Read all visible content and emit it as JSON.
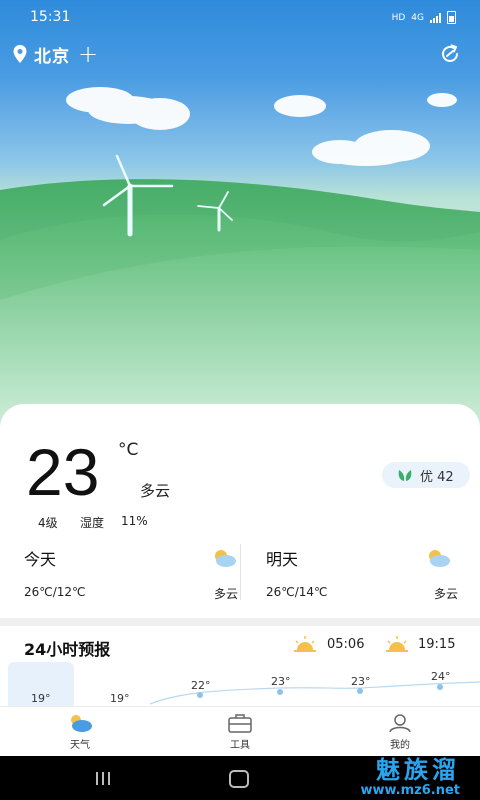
{
  "status_bar": {
    "time": "15:31",
    "network_badge": "HD",
    "network_type": "4G"
  },
  "location": {
    "city": "北京",
    "add_icon": "+"
  },
  "current": {
    "temperature": "23",
    "unit": "°C",
    "condition": "多云",
    "wind": "4级",
    "humidity_label": "湿度",
    "humidity": "11%",
    "aqi": "优 42"
  },
  "today": {
    "label": "今天",
    "range": "26℃/12℃",
    "condition": "多云"
  },
  "tomorrow": {
    "label": "明天",
    "range": "26℃/14℃",
    "condition": "多云"
  },
  "forecast": {
    "title": "24小时预报",
    "sunrise": "05:06",
    "sunset": "19:15",
    "hours": [
      {
        "temp": "19°"
      },
      {
        "temp": "19°"
      },
      {
        "temp": "22°"
      },
      {
        "temp": "23°"
      },
      {
        "temp": "23°"
      },
      {
        "temp": "24°"
      }
    ]
  },
  "nav": {
    "weather": "天气",
    "tools": "工具",
    "mine": "我的"
  },
  "watermark": {
    "name": "魅族溜",
    "url": "www.mz6.net"
  },
  "colors": {
    "accent": "#2f8bdc",
    "hills": "#4caf6a",
    "aqi_bg": "#eaf2fb",
    "watermark": "#2aa6f0"
  }
}
